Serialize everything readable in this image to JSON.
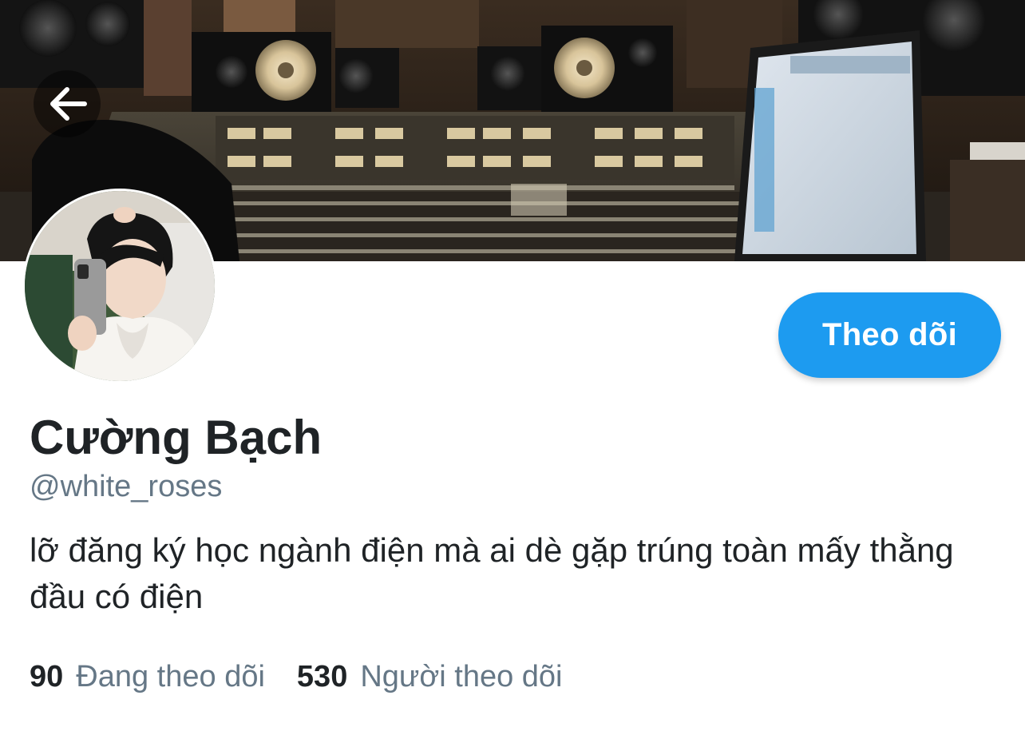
{
  "header": {
    "back_icon": "arrow-left-icon",
    "banner_alt": "recording studio mixing console"
  },
  "profile": {
    "display_name": "Cường Bạch",
    "handle": "@white_roses",
    "bio": "lỡ đăng ký học ngành điện mà ai dè gặp trúng toàn mấy thằng đầu có điện",
    "follow_label": "Theo dõi"
  },
  "stats": {
    "following_count": "90",
    "following_label": "Đang theo dõi",
    "followers_count": "530",
    "followers_label": "Người theo dõi"
  },
  "colors": {
    "accent": "#1d9bf0",
    "text_primary": "#1f2326",
    "text_secondary": "#657786"
  }
}
